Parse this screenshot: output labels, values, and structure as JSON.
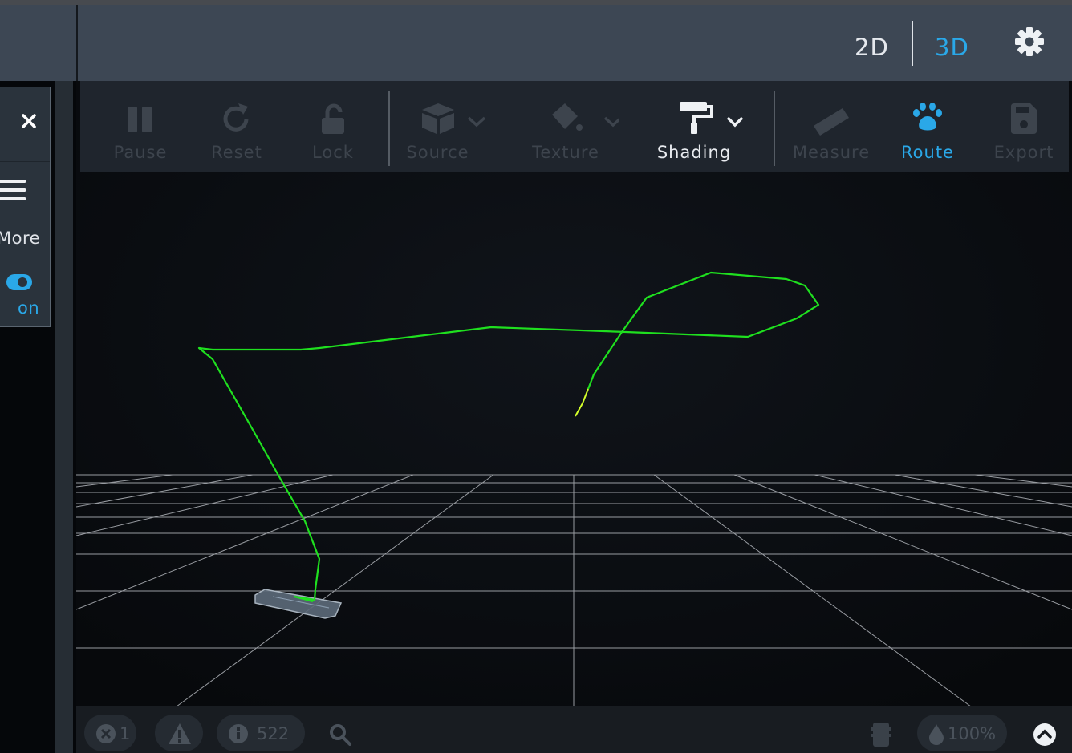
{
  "header": {
    "view_2d": "2D",
    "view_3d": "3D",
    "active_view": "3D",
    "settings_icon": "gear-icon"
  },
  "sidebar": {
    "close_icon": "close-icon",
    "menu_icon": "hamburger-icon",
    "more_label": "More",
    "toggle_label": "on",
    "toggle_state": true
  },
  "toolbar": {
    "items": [
      {
        "label": "Pause",
        "icon": "pause-icon",
        "state": "disabled"
      },
      {
        "label": "Reset",
        "icon": "reset-icon",
        "state": "disabled"
      },
      {
        "label": "Lock",
        "icon": "unlock-icon",
        "state": "disabled"
      },
      {
        "label": "Source",
        "icon": "cube-icon",
        "state": "disabled",
        "dropdown": true
      },
      {
        "label": "Texture",
        "icon": "paint-bucket-icon",
        "state": "disabled",
        "dropdown": true
      },
      {
        "label": "Shading",
        "icon": "paint-roller-icon",
        "state": "enabled",
        "dropdown": true
      },
      {
        "label": "Measure",
        "icon": "ruler-icon",
        "state": "disabled"
      },
      {
        "label": "Route",
        "icon": "paw-icon",
        "state": "active"
      },
      {
        "label": "Export",
        "icon": "save-icon",
        "state": "disabled"
      }
    ]
  },
  "status": {
    "errors": "1",
    "warnings_icon": "warning-icon",
    "info_count": "522",
    "search_icon": "search-icon",
    "battery_icon": "battery-icon",
    "opacity": "100%",
    "collapse_icon": "chevron-up-icon"
  },
  "colors": {
    "accent": "#2aa8e8",
    "route": "#1fe01f",
    "header_bg": "#3d4754",
    "toolbar_bg": "#1f252d"
  }
}
